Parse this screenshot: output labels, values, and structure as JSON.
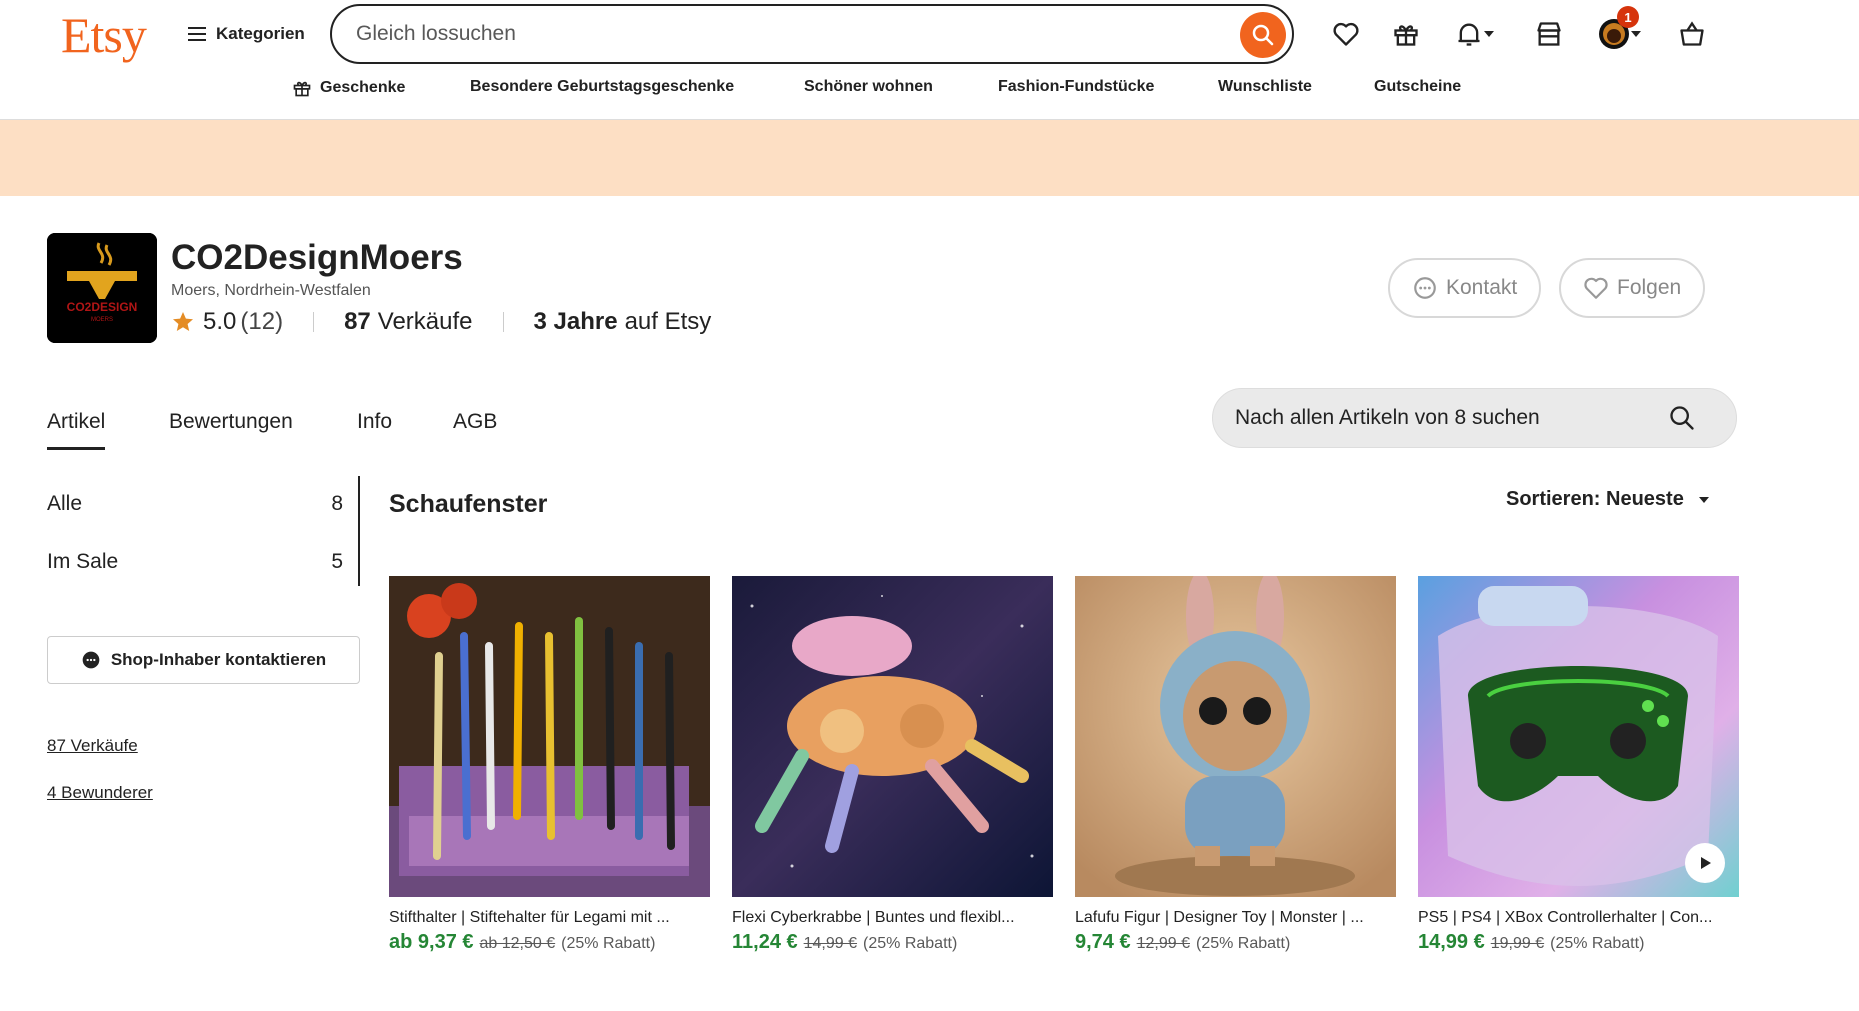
{
  "header": {
    "logo": "Etsy",
    "categories_label": "Kategorien",
    "search_placeholder": "Gleich lossuchen",
    "cart_badge": "1",
    "nav": [
      "Geschenke",
      "Besondere Geburtstagsgeschenke",
      "Schöner wohnen",
      "Fashion-Fundstücke",
      "Wunschliste",
      "Gutscheine"
    ]
  },
  "shop": {
    "name": "CO2DesignMoers",
    "location": "Moers, Nordrhein-Westfalen",
    "rating": "5.0",
    "rating_count": "(12)",
    "sales": "87",
    "sales_label": "Verkäufe",
    "years": "3 Jahre",
    "years_suffix": "auf Etsy",
    "contact_label": "Kontakt",
    "follow_label": "Folgen",
    "logo_text": "CO2DESIGN",
    "logo_subtext": "MOERS"
  },
  "tabs": [
    "Artikel",
    "Bewertungen",
    "Info",
    "AGB"
  ],
  "shop_search_placeholder": "Nach allen Artikeln von 8 suchen",
  "sidebar": {
    "items": [
      {
        "label": "Alle",
        "count": "8"
      },
      {
        "label": "Im Sale",
        "count": "5"
      }
    ],
    "contact_owner": "Shop-Inhaber kontaktieren",
    "sales_link": "87 Verkäufe",
    "fans_link": "4 Bewunderer"
  },
  "section": {
    "title": "Schaufenster",
    "sort_label": "Sortieren: Neueste"
  },
  "listings": [
    {
      "title": "Stifthalter | Stiftehalter für Legami mit ...",
      "price": "ab 9,37 €",
      "old_price": "ab 12,50 €",
      "discount": "(25% Rabatt)"
    },
    {
      "title": "Flexi Cyberkrabbe | Buntes und flexibl...",
      "price": "11,24 €",
      "old_price": "14,99 €",
      "discount": "(25% Rabatt)"
    },
    {
      "title": "Lafufu Figur | Designer Toy | Monster | ...",
      "price": "9,74 €",
      "old_price": "12,99 €",
      "discount": "(25% Rabatt)"
    },
    {
      "title": "PS5 | PS4 | XBox Controllerhalter | Con...",
      "price": "14,99 €",
      "old_price": "19,99 €",
      "discount": "(25% Rabatt)"
    }
  ],
  "colors": {
    "brand": "#f1641e",
    "banner": "#fddfc4",
    "price": "#258635"
  }
}
